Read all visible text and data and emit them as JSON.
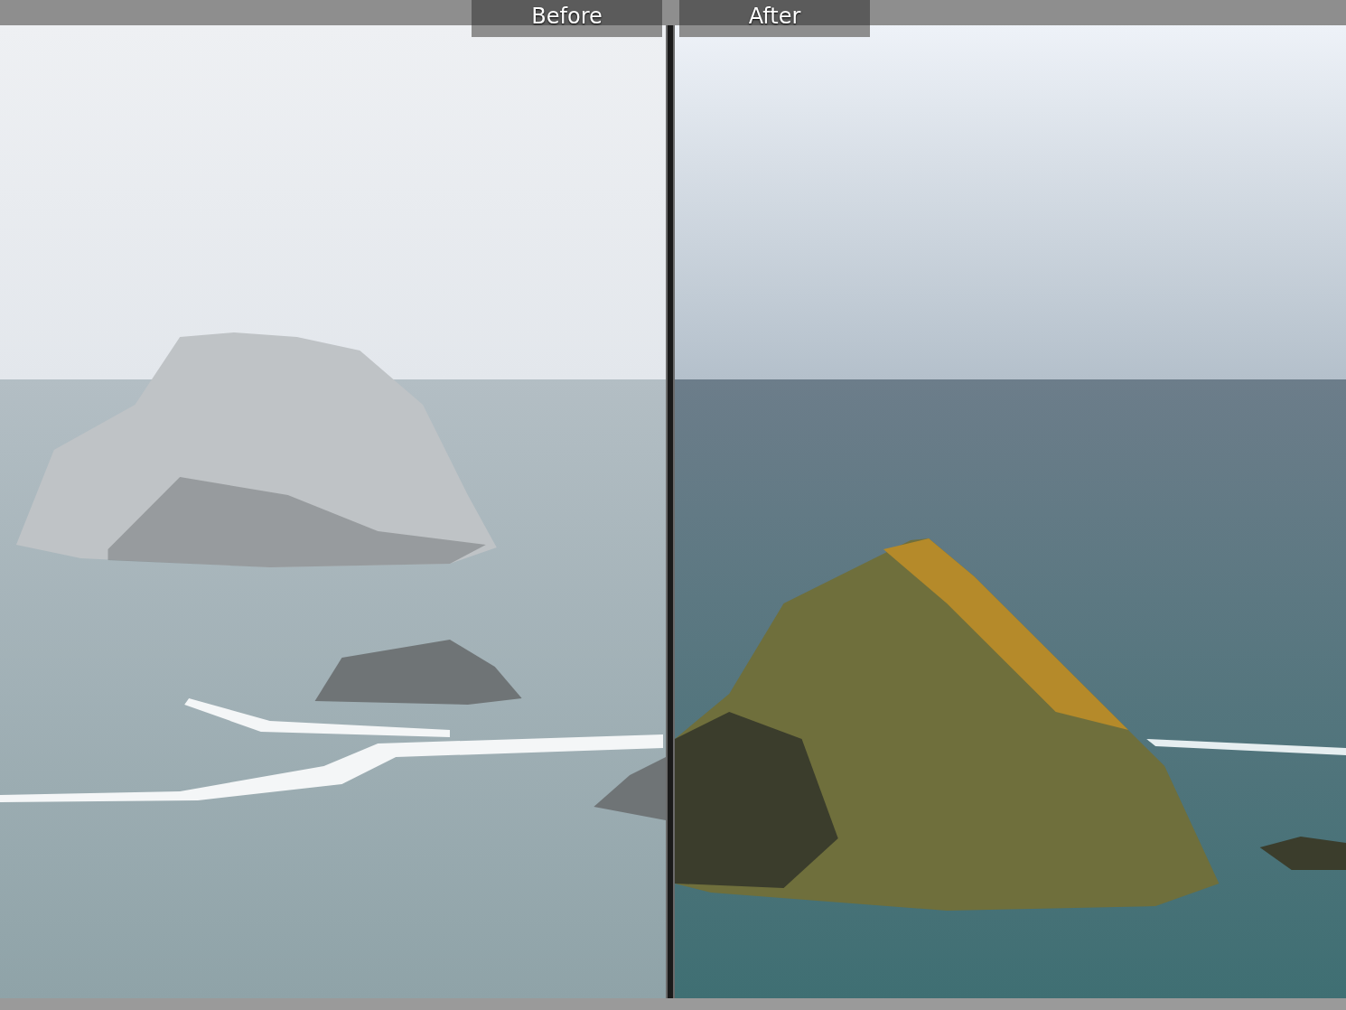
{
  "panels": [
    {
      "label": "Before"
    },
    {
      "label": "After"
    }
  ]
}
